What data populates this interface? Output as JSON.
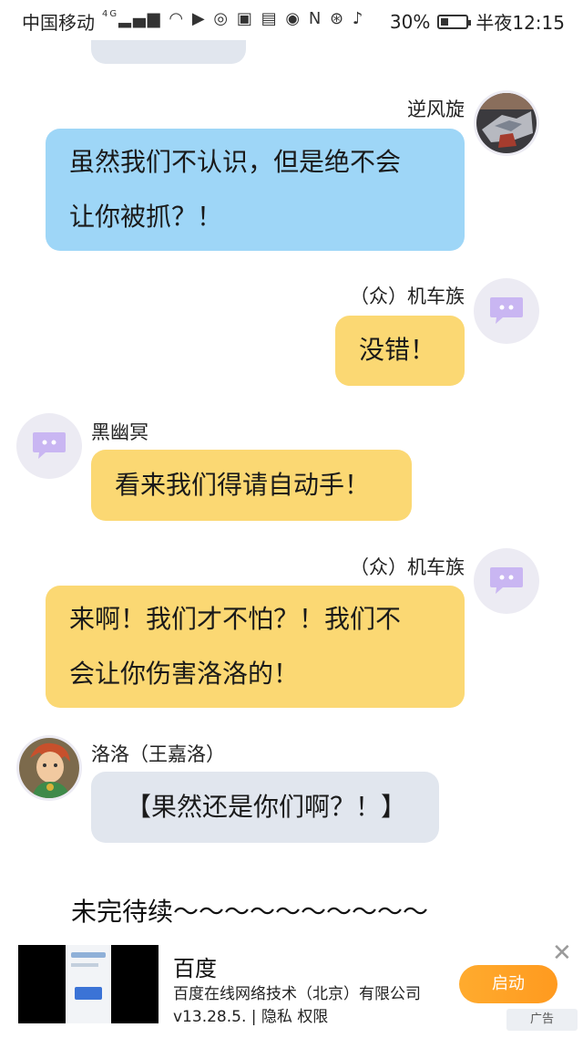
{
  "status_bar": {
    "carrier": "中国移动",
    "network": "4G",
    "battery": "30%",
    "battery_level": 0.3,
    "time": "半夜12:15"
  },
  "messages": [
    {
      "side": "left",
      "sender": "",
      "text": "",
      "bubble_color": "#e1e6ee",
      "partial": true
    },
    {
      "side": "right",
      "sender": "逆风旋",
      "lines": [
        "虽然我们不认识，但是绝不会",
        "让你被抓？！"
      ],
      "bubble_color": "#9ed6f7",
      "avatar": "photo-avatar"
    },
    {
      "side": "right",
      "sender": "（众）机车族",
      "lines": [
        "没错！"
      ],
      "bubble_color": "#fbd873",
      "avatar": "chat-bubble-icon"
    },
    {
      "side": "left",
      "sender": "黑幽冥",
      "lines": [
        "看来我们得请自动手！"
      ],
      "bubble_color": "#fbd873",
      "avatar": "chat-bubble-icon"
    },
    {
      "side": "right",
      "sender": "（众）机车族",
      "lines": [
        "来啊！我们才不怕？！我们不",
        "会让你伤害洛洛的！"
      ],
      "bubble_color": "#fbd873",
      "avatar": "chat-bubble-icon"
    },
    {
      "side": "left",
      "sender": "洛洛（王嘉洛）",
      "lines": [
        "【果然还是你们啊？！】"
      ],
      "bubble_color": "#e1e6ee",
      "avatar": "cartoon-avatar"
    }
  ],
  "footer_text": "未完待续～～～～～～～～～～",
  "ad": {
    "title": "百度",
    "company": "百度在线网络技术（北京）有限公司",
    "version": "v13.28.5.",
    "privacy": "隐私",
    "permissions": "权限",
    "button": "启动",
    "tag": "广告",
    "close": "✕",
    "button_color": "#ff9f24"
  }
}
